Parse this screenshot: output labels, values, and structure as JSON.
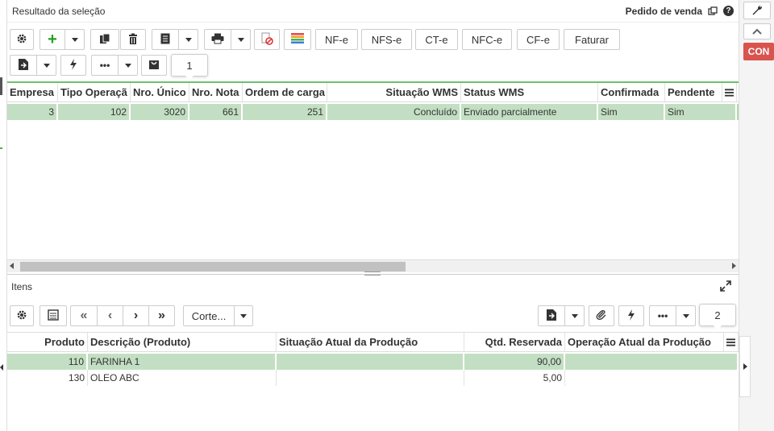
{
  "header": {
    "title": "Resultado da seleção",
    "context_label": "Pedido de venda"
  },
  "rail": {
    "con_label": "CON"
  },
  "toolbar": {
    "nfe": "NF-e",
    "nfse": "NFS-e",
    "cte": "CT-e",
    "nfce": "NFC-e",
    "cfe": "CF-e",
    "faturar": "Faturar",
    "more": "•••",
    "page": "1"
  },
  "grid1": {
    "columns": [
      "Empresa",
      "Tipo Operaçã",
      "Nro. Único",
      "Nro. Nota",
      "Ordem de carga",
      "Situação WMS",
      "Status WMS",
      "Confirmada",
      "Pendente"
    ],
    "rows": [
      [
        "3",
        "102",
        "3020",
        "661",
        "251",
        "Concluído",
        "Enviado parcialmente",
        "Sim",
        "Sim"
      ]
    ]
  },
  "items": {
    "title": "Itens",
    "toolbar": {
      "corte": "Corte...",
      "more": "•••",
      "page": "2"
    },
    "columns": [
      "Produto",
      "Descrição (Produto)",
      "Situação Atual da Produção",
      "Qtd. Reservada",
      "Operação Atual da Produção"
    ],
    "rows": [
      [
        "110",
        "FARINHA 1",
        "",
        "90,00",
        ""
      ],
      [
        "130",
        "OLEO ABC",
        "",
        "5,00",
        ""
      ]
    ]
  },
  "colors": {
    "selected_row": "#c3dfc3",
    "con_badge": "#d9534f",
    "accent_green": "#22a022"
  }
}
